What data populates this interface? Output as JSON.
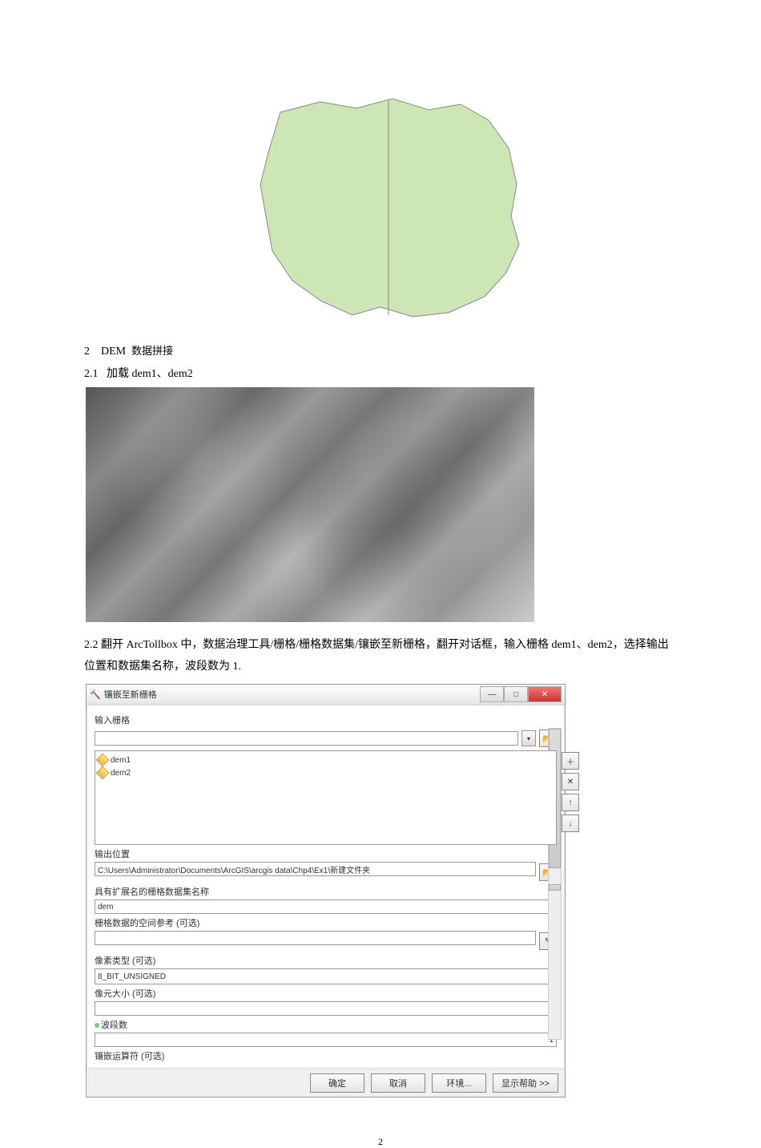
{
  "section": {
    "num": "2",
    "title_en": "DEM",
    "title_zh": "数据拼接"
  },
  "sub1": {
    "num": "2.1",
    "text": "加载 dem1、dem2"
  },
  "para22": "2.2  翻开 ArcTollbox 中，数据治理工具/栅格/栅格数据集/镶嵌至新栅格，翻开对话框，输入栅格 dem1、dem2，选择输出位置和数据集名称，波段数为 1.",
  "dialog": {
    "title": "镶嵌至新栅格",
    "labels": {
      "input_raster": "输入栅格",
      "out_location": "输出位置",
      "out_name": "具有扩展名的栅格数据集名称",
      "spatial_ref": "栅格数据的空间参考 (可选)",
      "pixel_type": "像素类型 (可选)",
      "cell_size": "像元大小 (可选)",
      "bands": "波段数",
      "mosaic_op": "镶嵌运算符 (可选)"
    },
    "items": [
      "dem1",
      "dem2"
    ],
    "out_path": "C:\\Users\\Administrator\\Documents\\ArcGIS\\arcgis data\\Chp4\\Ex1\\新建文件夹",
    "out_name_val": "dem",
    "pixel_type_val": "8_BIT_UNSIGNED",
    "bands_val": "1",
    "buttons": {
      "ok": "确定",
      "cancel": "取消",
      "env": "环境...",
      "help": "显示帮助 >>"
    },
    "win": {
      "min": "—",
      "max": "□",
      "close": "✕"
    }
  },
  "pagenum": "2"
}
